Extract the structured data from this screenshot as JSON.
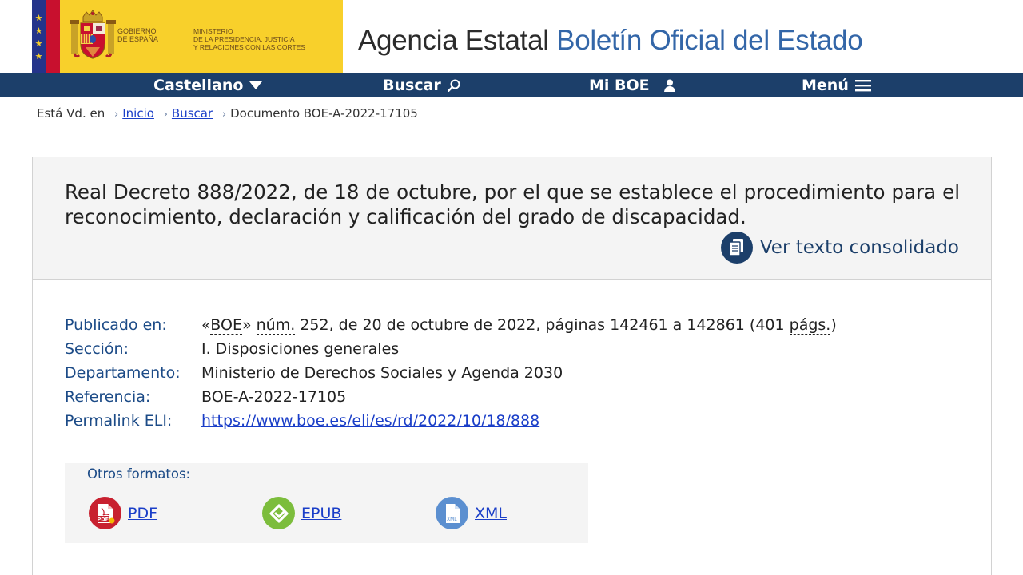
{
  "header": {
    "gov_text": [
      "Gobierno",
      "de España"
    ],
    "ministry_text": [
      "Ministerio",
      "de la Presidencia, Justicia",
      "y Relaciones con las Cortes"
    ],
    "site_title_prefix": "Agencia Estatal",
    "site_title_accent": "Boletín Oficial del Estado"
  },
  "nav": {
    "language": "Castellano",
    "search": "Buscar",
    "miboe": "Mi BOE",
    "menu": "Menú"
  },
  "breadcrumb": {
    "prefix_a": "Está",
    "prefix_abbr": "Vd.",
    "prefix_b": "en",
    "items": [
      "Inicio",
      "Buscar"
    ],
    "current": "Documento BOE-A-2022-17105"
  },
  "document": {
    "title": "Real Decreto 888/2022, de 18 de octubre, por el que se establece el procedimiento para el reconocimiento, declaración y calificación del grado de discapacidad.",
    "consolidated_link": "Ver texto consolidado",
    "metadata": {
      "published": {
        "label": "Publicado en:",
        "open_quote": "«",
        "boe": "BOE",
        "close_quote": "» ",
        "num": "núm.",
        "rest": " 252, de 20 de octubre de 2022, páginas 142461 a 142861 (401 ",
        "pags": "págs.",
        "end": ")"
      },
      "section": {
        "label": "Sección:",
        "value": "I. Disposiciones generales"
      },
      "department": {
        "label": "Departamento:",
        "value": "Ministerio de Derechos Sociales y Agenda 2030"
      },
      "reference": {
        "label": "Referencia:",
        "value": "BOE-A-2022-17105"
      },
      "permalink": {
        "label": "Permalink ELI:",
        "value": "https://www.boe.es/eli/es/rd/2022/10/18/888"
      }
    },
    "formats": {
      "title": "Otros formatos:",
      "items": [
        {
          "label": "PDF",
          "icon": "pdf-icon",
          "color": "#c8202f"
        },
        {
          "label": "EPUB",
          "icon": "epub-icon",
          "color": "#7cbd3c"
        },
        {
          "label": "XML",
          "icon": "xml-icon",
          "color": "#5b8fd0"
        }
      ]
    }
  },
  "colors": {
    "nav_bg": "#1c3f6a",
    "gov_yellow": "#f8d02b",
    "link": "#1a3ec8",
    "label_blue": "#1c4b87"
  }
}
